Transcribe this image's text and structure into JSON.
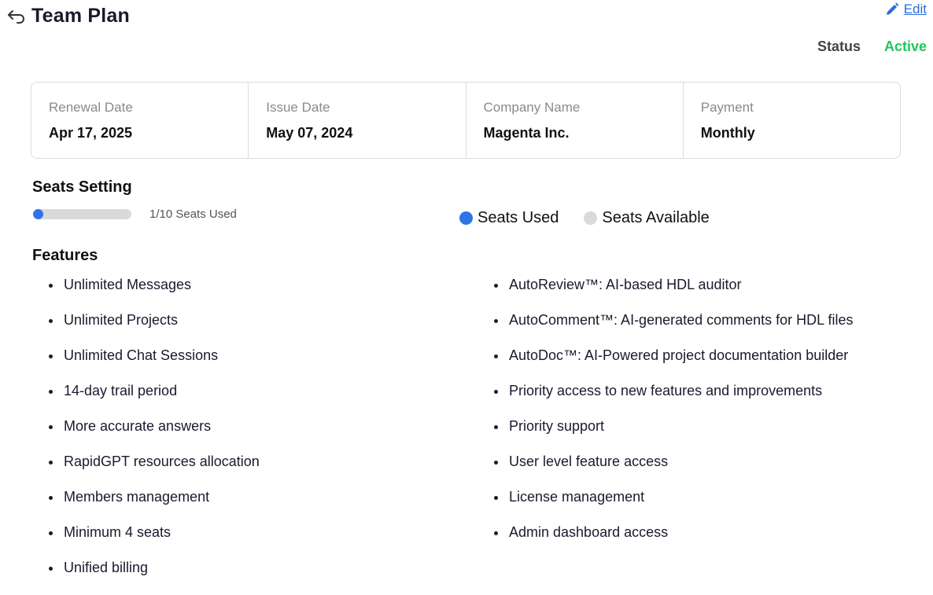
{
  "header": {
    "title": "Team Plan",
    "edit_label": "Edit"
  },
  "status": {
    "label": "Status",
    "value": "Active",
    "value_color": "#22c55e"
  },
  "info": [
    {
      "label": "Renewal Date",
      "value": "Apr 17, 2025"
    },
    {
      "label": "Issue Date",
      "value": "May 07, 2024"
    },
    {
      "label": "Company Name",
      "value": "Magenta Inc."
    },
    {
      "label": "Payment",
      "value": "Monthly"
    }
  ],
  "seats": {
    "title": "Seats Setting",
    "used": 1,
    "total": 10,
    "text": "1/10 Seats Used",
    "legend": {
      "used_label": "Seats Used",
      "used_color": "#2f74e8",
      "available_label": "Seats Available",
      "available_color": "#d9d9d9"
    }
  },
  "features": {
    "title": "Features",
    "left": [
      "Unlimited Messages",
      "Unlimited Projects",
      "Unlimited Chat Sessions",
      "14-day trail period",
      "More accurate answers",
      "RapidGPT resources allocation",
      "Members management",
      "Minimum 4 seats",
      "Unified billing"
    ],
    "right": [
      "AutoReview™: AI-based HDL auditor",
      "AutoComment™: AI-generated comments for HDL files",
      "AutoDoc™: AI-Powered project documentation builder",
      "Priority access to new features and improvements",
      "Priority support",
      "User level feature access",
      "License management",
      "Admin dashboard access"
    ]
  },
  "icons": {
    "back": "back-arrow-icon",
    "edit": "pencil-icon"
  }
}
